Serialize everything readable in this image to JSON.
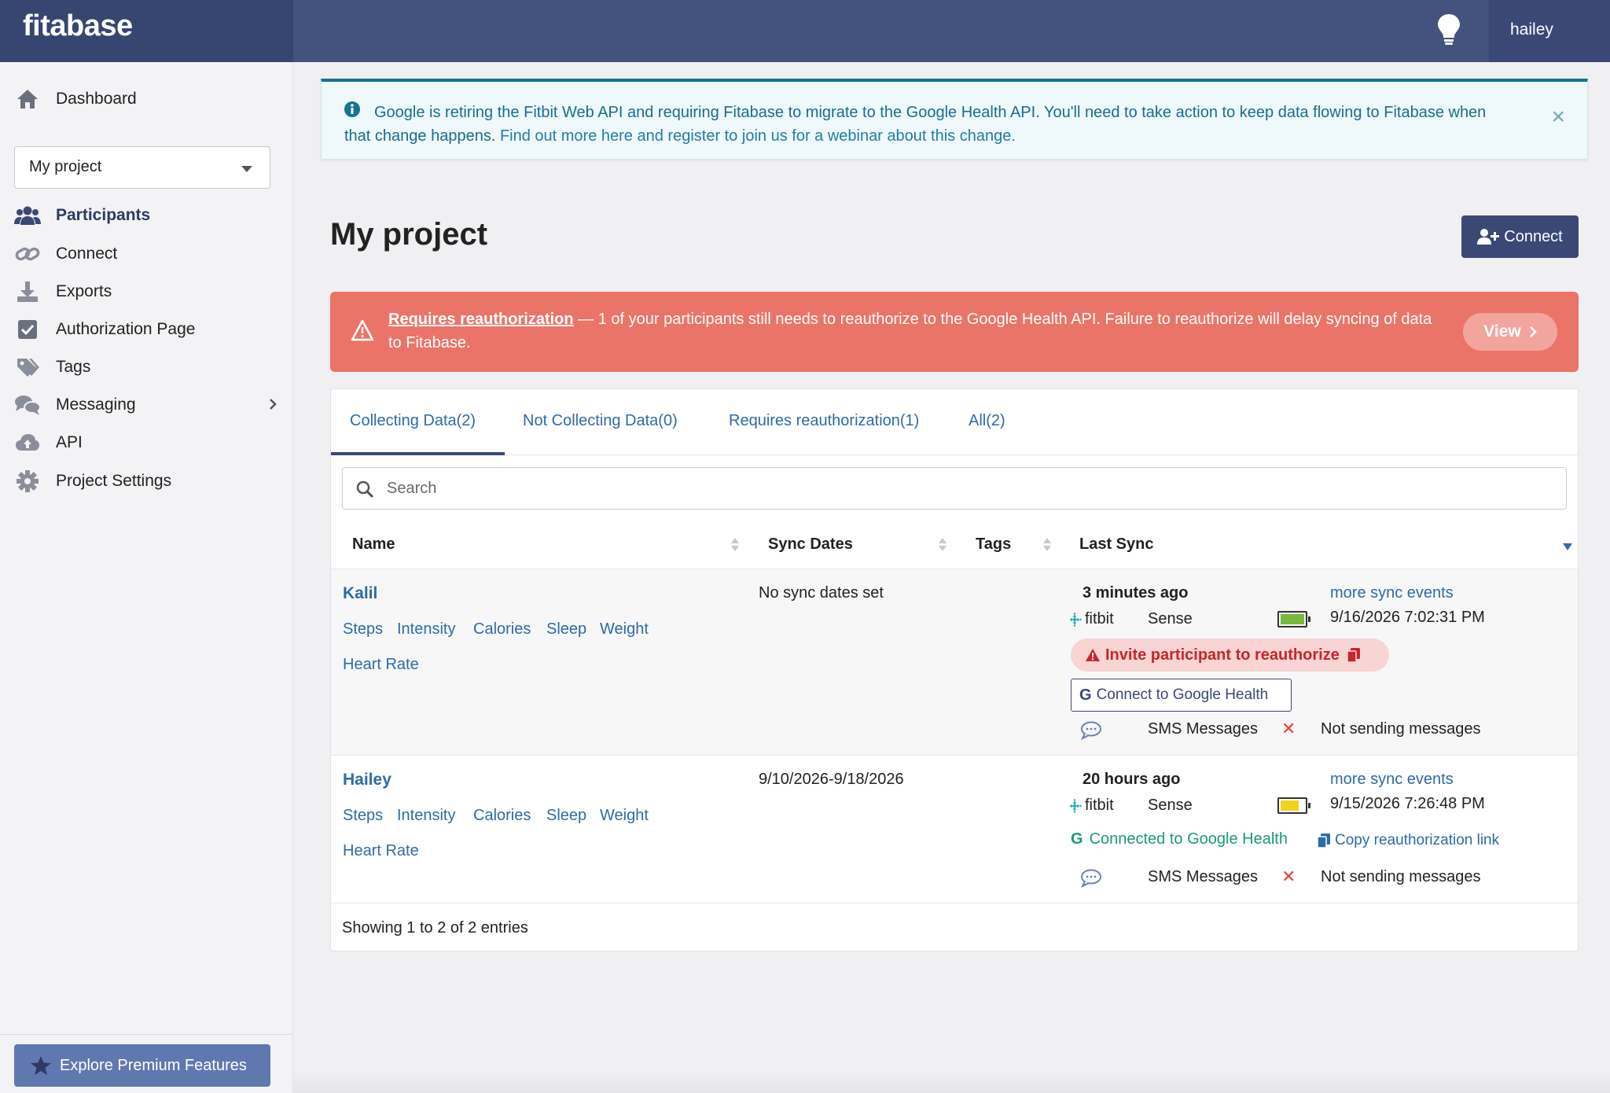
{
  "header": {
    "brand": "fitabase",
    "user": "hailey",
    "bulb_icon": "lightbulb-icon"
  },
  "sidebar": {
    "dashboard": "Dashboard",
    "project_select": "My project",
    "items": [
      {
        "label": "Participants",
        "icon": "users-icon",
        "active": true
      },
      {
        "label": "Connect",
        "icon": "link-icon"
      },
      {
        "label": "Exports",
        "icon": "download-icon"
      },
      {
        "label": "Authorization Page",
        "icon": "checkbox-icon"
      },
      {
        "label": "Tags",
        "icon": "tags-icon"
      },
      {
        "label": "Messaging",
        "icon": "comments-icon",
        "has_submenu": true
      },
      {
        "label": "API",
        "icon": "cloud-upload-icon"
      },
      {
        "label": "Project Settings",
        "icon": "gear-icon"
      }
    ],
    "premium": "Explore Premium Features"
  },
  "info_banner": {
    "text": "Google is retiring the Fitbit Web API and requiring Fitabase to migrate to the Google Health API. You'll need to take action to keep data flowing to Fitabase when that change happens.",
    "link": "Find out more here and register to join us for a webinar about this change.",
    "close": "×"
  },
  "page": {
    "title": "My project",
    "connect_button": "Connect"
  },
  "alert": {
    "link": "Requires reauthorization",
    "text": " — 1 of your participants still needs to reauthorize to the Google Health API. Failure to reauthorize will delay syncing of data to Fitabase.",
    "view_button": "View"
  },
  "tabs": [
    {
      "label": "Collecting Data(2)",
      "active": true
    },
    {
      "label": "Not Collecting Data(0)"
    },
    {
      "label": "Requires reauthorization(1)"
    },
    {
      "label": "All(2)"
    }
  ],
  "search": {
    "placeholder": "Search"
  },
  "columns": [
    "Name",
    "Sync Dates",
    "Tags",
    "Last Sync"
  ],
  "participants": [
    {
      "name": "Kalil",
      "metrics": [
        "Steps",
        "Intensity",
        "Calories",
        "Sleep",
        "Weight",
        "Heart Rate"
      ],
      "sync_dates": "No sync dates set",
      "last_sync": "3 minutes ago",
      "more_link": "more sync events",
      "brand": "fitbit",
      "device": "Sense",
      "battery_color": "#7ab83a",
      "battery_level": 1.0,
      "datetime": "9/16/2026 7:02:31 PM",
      "invite": "Invite participant to reauthorize",
      "google_button": "Connect to Google Health",
      "sms_label": "SMS Messages",
      "sms_status": "Not sending messages"
    },
    {
      "name": "Hailey",
      "metrics": [
        "Steps",
        "Intensity",
        "Calories",
        "Sleep",
        "Weight",
        "Heart Rate"
      ],
      "sync_dates": "9/10/2026-9/18/2026",
      "last_sync": "20 hours ago",
      "more_link": "more sync events",
      "brand": "fitbit",
      "device": "Sense",
      "battery_color": "#f2d21a",
      "battery_level": 0.75,
      "datetime": "9/15/2026 7:26:48 PM",
      "connected": "Connected to Google Health",
      "copy_link": "Copy reauthorization link",
      "sms_label": "SMS Messages",
      "sms_status": "Not sending messages"
    }
  ],
  "footer": {
    "entries": "Showing 1 to 2 of 2 entries"
  }
}
